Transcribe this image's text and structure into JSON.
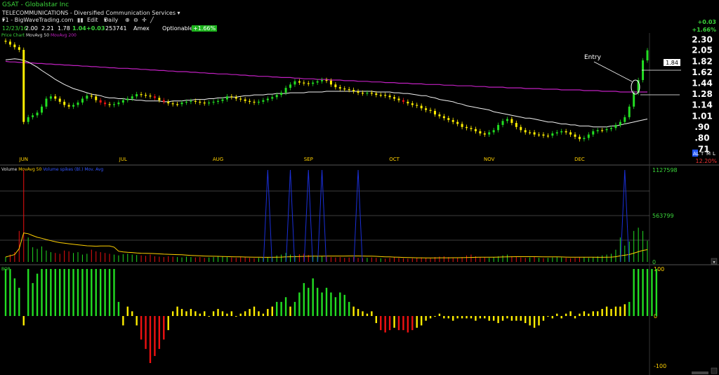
{
  "header": {
    "symbol_line": "GSAT - Globalstar Inc",
    "industry_line": "TELECOMMUNICATIONS - Diversified Communication Services"
  },
  "toolbar": {
    "layout_label": "F1 - BigWaveTrading.com",
    "edit_label": "Edit",
    "period_label": "Daily"
  },
  "quote": {
    "date": "12/23/16",
    "open": "2.00",
    "high": "2.21",
    "low": "1.78",
    "close": "1.04",
    "change": "+0.03",
    "volume": "253741",
    "exchange": "Amex",
    "optionable": "Optionable",
    "pct_box": "+1.66%"
  },
  "top_right": {
    "change": "+0.03",
    "pct": "+1.66%"
  },
  "colors": {
    "up": "#22dd22",
    "down_red": "#ee1111",
    "neutral_yellow": "#ffee00",
    "ma50": "#f2f2f2",
    "ma200": "#c020c0",
    "volume_ma": "#ffd000",
    "grid": "#7a7a7a"
  },
  "price_pane": {
    "title_price": "Price Chart",
    "title_ma50": "MovAvg 50",
    "title_ma200": "MovAvg 200",
    "last_price_box": "1.84",
    "annotation": "Entry",
    "bottom_tags": [
      "AL",
      "T",
      "M",
      "L"
    ],
    "bottom_pct": "12.20%"
  },
  "volume_pane": {
    "title_volume": "Volume",
    "title_ma": "MovAvg 50",
    "title_extra": "Volume spikes (Bl.) Mov. Avg",
    "tick_labels": [
      "1127598",
      "563799",
      "0"
    ]
  },
  "osc_pane": {
    "title": "BOP",
    "tick_labels": [
      "100",
      "0",
      "-100"
    ]
  },
  "chart_data": [
    {
      "type": "candlestick",
      "title": "GSAT - Globalstar Inc",
      "x_tick_labels": [
        "JUN",
        "JUL",
        "AUG",
        "SEP",
        "OCT",
        "NOV",
        "DEC"
      ],
      "y_tick_labels": [
        "2.30",
        "2.05",
        "1.82",
        "1.62",
        "1.44",
        "1.28",
        "1.14",
        "1.01",
        ".90",
        ".80",
        ".71"
      ],
      "y_scale": "log",
      "ylim": [
        0.68,
        2.45
      ],
      "n_bars": 143,
      "close": [
        2.25,
        2.18,
        2.12,
        2.06,
        0.95,
        1.0,
        1.02,
        1.05,
        1.12,
        1.22,
        1.25,
        1.22,
        1.18,
        1.14,
        1.12,
        1.14,
        1.17,
        1.22,
        1.26,
        1.25,
        1.2,
        1.17,
        1.15,
        1.14,
        1.15,
        1.17,
        1.2,
        1.22,
        1.25,
        1.28,
        1.27,
        1.26,
        1.25,
        1.23,
        1.2,
        1.18,
        1.16,
        1.15,
        1.15,
        1.17,
        1.18,
        1.19,
        1.18,
        1.17,
        1.16,
        1.17,
        1.18,
        1.19,
        1.21,
        1.25,
        1.24,
        1.22,
        1.21,
        1.19,
        1.18,
        1.17,
        1.18,
        1.2,
        1.22,
        1.24,
        1.27,
        1.3,
        1.37,
        1.42,
        1.47,
        1.45,
        1.44,
        1.43,
        1.45,
        1.47,
        1.49,
        1.48,
        1.42,
        1.38,
        1.36,
        1.35,
        1.34,
        1.32,
        1.3,
        1.29,
        1.3,
        1.29,
        1.27,
        1.27,
        1.26,
        1.24,
        1.22,
        1.2,
        1.18,
        1.16,
        1.14,
        1.13,
        1.1,
        1.08,
        1.07,
        1.03,
        1.01,
        0.99,
        0.97,
        0.95,
        0.93,
        0.9,
        0.89,
        0.88,
        0.86,
        0.84,
        0.83,
        0.85,
        0.87,
        0.92,
        0.96,
        0.98,
        0.94,
        0.9,
        0.87,
        0.85,
        0.85,
        0.83,
        0.83,
        0.82,
        0.82,
        0.84,
        0.85,
        0.86,
        0.85,
        0.83,
        0.81,
        0.79,
        0.8,
        0.83,
        0.86,
        0.87,
        0.87,
        0.88,
        0.89,
        0.92,
        0.95,
        1.0,
        1.12,
        1.3,
        1.49,
        1.84,
        2.05
      ],
      "ma50": [
        1.85,
        1.86,
        1.87,
        1.86,
        1.84,
        1.81,
        1.76,
        1.71,
        1.65,
        1.6,
        1.55,
        1.5,
        1.46,
        1.42,
        1.39,
        1.36,
        1.34,
        1.32,
        1.3,
        1.28,
        1.27,
        1.26,
        1.24,
        1.23,
        1.23,
        1.22,
        1.22,
        1.21,
        1.21,
        1.2,
        1.2,
        1.19,
        1.19,
        1.19,
        1.19,
        1.18,
        1.18,
        1.19,
        1.19,
        1.19,
        1.2,
        1.2,
        1.21,
        1.21,
        1.21,
        1.22,
        1.22,
        1.23,
        1.23,
        1.24,
        1.24,
        1.24,
        1.25,
        1.26,
        1.26,
        1.27,
        1.27,
        1.27,
        1.28,
        1.28,
        1.29,
        1.29,
        1.29,
        1.3,
        1.3,
        1.3,
        1.3,
        1.31,
        1.31,
        1.31,
        1.31,
        1.32,
        1.32,
        1.32,
        1.32,
        1.32,
        1.32,
        1.32,
        1.32,
        1.32,
        1.32,
        1.32,
        1.31,
        1.31,
        1.31,
        1.31,
        1.3,
        1.3,
        1.29,
        1.29,
        1.28,
        1.27,
        1.26,
        1.26,
        1.24,
        1.23,
        1.21,
        1.2,
        1.19,
        1.18,
        1.16,
        1.15,
        1.13,
        1.12,
        1.11,
        1.1,
        1.09,
        1.08,
        1.06,
        1.05,
        1.04,
        1.03,
        1.02,
        1.01,
        1.0,
        0.99,
        0.99,
        0.98,
        0.97,
        0.96,
        0.95,
        0.95,
        0.94,
        0.93,
        0.93,
        0.92,
        0.92,
        0.91,
        0.91,
        0.91,
        0.9,
        0.9,
        0.9,
        0.9,
        0.91,
        0.91,
        0.92,
        0.93,
        0.94,
        0.95,
        0.96,
        0.97,
        0.98
      ],
      "ma200": [
        1.82,
        1.81,
        1.81,
        1.8,
        1.8,
        1.79,
        1.79,
        1.78,
        1.78,
        1.77,
        1.77,
        1.76,
        1.76,
        1.75,
        1.75,
        1.74,
        1.74,
        1.73,
        1.73,
        1.72,
        1.72,
        1.71,
        1.71,
        1.7,
        1.7,
        1.69,
        1.69,
        1.69,
        1.68,
        1.68,
        1.67,
        1.67,
        1.66,
        1.66,
        1.65,
        1.65,
        1.64,
        1.64,
        1.63,
        1.63,
        1.63,
        1.62,
        1.62,
        1.61,
        1.61,
        1.6,
        1.6,
        1.59,
        1.59,
        1.59,
        1.58,
        1.58,
        1.57,
        1.57,
        1.56,
        1.56,
        1.55,
        1.55,
        1.55,
        1.54,
        1.54,
        1.53,
        1.53,
        1.53,
        1.52,
        1.52,
        1.51,
        1.51,
        1.51,
        1.5,
        1.5,
        1.5,
        1.49,
        1.49,
        1.49,
        1.48,
        1.48,
        1.48,
        1.47,
        1.47,
        1.47,
        1.46,
        1.46,
        1.46,
        1.45,
        1.45,
        1.45,
        1.44,
        1.44,
        1.44,
        1.43,
        1.43,
        1.43,
        1.42,
        1.42,
        1.42,
        1.42,
        1.41,
        1.41,
        1.41,
        1.4,
        1.4,
        1.4,
        1.4,
        1.39,
        1.39,
        1.39,
        1.38,
        1.38,
        1.38,
        1.38,
        1.37,
        1.37,
        1.37,
        1.37,
        1.36,
        1.36,
        1.36,
        1.36,
        1.35,
        1.35,
        1.35,
        1.35,
        1.34,
        1.34,
        1.34,
        1.34,
        1.34,
        1.33,
        1.33,
        1.33,
        1.33,
        1.32,
        1.32,
        1.32,
        1.32,
        1.31,
        1.31,
        1.31,
        1.31,
        1.31,
        1.31,
        1.31
      ]
    },
    {
      "type": "bar",
      "title": "Volume",
      "y_tick_labels": [
        "1127598",
        "563799",
        "0"
      ],
      "ylim": [
        0,
        1127598
      ],
      "spikes": [
        {
          "bar": 58,
          "value": 1127598
        },
        {
          "bar": 63,
          "value": 1127598
        },
        {
          "bar": 67,
          "value": 1127598
        },
        {
          "bar": 70,
          "value": 1127598
        },
        {
          "bar": 78,
          "value": 1127598
        },
        {
          "bar": 137,
          "value": 1127598
        }
      ],
      "values": [
        60000,
        90000,
        120000,
        380000,
        1127598,
        300000,
        180000,
        160000,
        190000,
        140000,
        120000,
        110000,
        100000,
        140000,
        130000,
        110000,
        120000,
        90000,
        100000,
        150000,
        130000,
        120000,
        110000,
        100000,
        90000,
        80000,
        95000,
        100000,
        90000,
        85000,
        80000,
        75000,
        90000,
        70000,
        65000,
        60000,
        70000,
        65000,
        60000,
        55000,
        65000,
        60000,
        55000,
        60000,
        50000,
        55000,
        60000,
        70000,
        65000,
        60000,
        55000,
        50000,
        60000,
        55000,
        50000,
        45000,
        50000,
        55000,
        60000,
        65000,
        80000,
        90000,
        110000,
        90000,
        80000,
        95000,
        100000,
        85000,
        80000,
        75000,
        70000,
        65000,
        60000,
        55000,
        60000,
        50000,
        55000,
        60000,
        50000,
        45000,
        50000,
        55000,
        50000,
        45000,
        40000,
        50000,
        55000,
        50000,
        45000,
        40000,
        45000,
        50000,
        55000,
        50000,
        45000,
        60000,
        65000,
        70000,
        60000,
        55000,
        50000,
        60000,
        80000,
        90000,
        70000,
        60000,
        55000,
        50000,
        60000,
        70000,
        80000,
        90000,
        70000,
        60000,
        55000,
        50000,
        55000,
        60000,
        50000,
        45000,
        50000,
        55000,
        60000,
        55000,
        50000,
        45000,
        50000,
        60000,
        55000,
        50000,
        60000,
        70000,
        80000,
        90000,
        100000,
        150000,
        300000,
        200000,
        250000,
        380000,
        420000,
        380000,
        260000
      ]
    },
    {
      "type": "bar",
      "title": "BOP",
      "y_tick_labels": [
        "100",
        "0",
        "-100"
      ],
      "ylim": [
        -100,
        100
      ],
      "values": [
        100,
        100,
        80,
        60,
        -20,
        100,
        70,
        90,
        100,
        100,
        100,
        100,
        100,
        100,
        100,
        100,
        100,
        100,
        100,
        100,
        100,
        100,
        100,
        100,
        100,
        30,
        -20,
        20,
        10,
        -20,
        -50,
        -70,
        -100,
        -85,
        -70,
        -50,
        -30,
        10,
        20,
        15,
        10,
        15,
        10,
        5,
        10,
        0,
        10,
        15,
        10,
        5,
        10,
        0,
        5,
        10,
        15,
        20,
        10,
        5,
        15,
        20,
        30,
        30,
        40,
        20,
        30,
        50,
        70,
        60,
        80,
        60,
        50,
        60,
        50,
        40,
        50,
        45,
        30,
        20,
        15,
        10,
        5,
        10,
        -15,
        -30,
        -35,
        -30,
        -25,
        -30,
        -30,
        -35,
        -30,
        -25,
        -20,
        -10,
        -5,
        0,
        5,
        -5,
        -5,
        -10,
        -5,
        -5,
        -5,
        -5,
        -10,
        -5,
        -5,
        -10,
        -10,
        -15,
        -10,
        -5,
        -10,
        -10,
        -10,
        -15,
        -20,
        -25,
        -20,
        -10,
        0,
        -5,
        5,
        -5,
        5,
        10,
        -5,
        5,
        10,
        5,
        10,
        10,
        15,
        20,
        15,
        20,
        20,
        25,
        30,
        100,
        100,
        100,
        100,
        100,
        100
      ]
    }
  ]
}
